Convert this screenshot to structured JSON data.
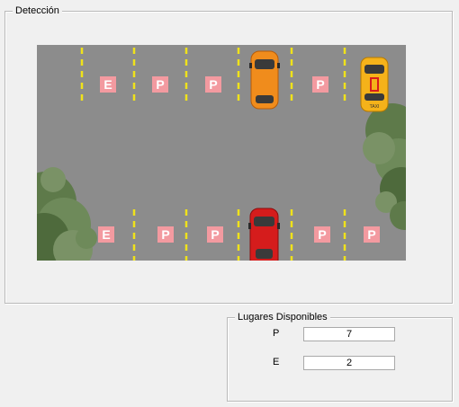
{
  "deteccion": {
    "title": "Detección",
    "lot": {
      "top_row": [
        "E",
        "P",
        "P",
        "",
        "P",
        ""
      ],
      "bottom_row": [
        "E",
        "P",
        "P",
        "",
        "P",
        "P"
      ],
      "taxi_label": "TAXI"
    },
    "colors": {
      "asphalt": "#8c8c8c",
      "line": "#f0e21a",
      "sign_bg": "#f39aa0",
      "orange_car": "#f08c1c",
      "red_car": "#d51c1c",
      "taxi": "#f5b21a",
      "tree": "#5e7a4a"
    }
  },
  "lugares": {
    "title": "Lugares Disponibles",
    "p_label": "P",
    "p_value": "7",
    "e_label": "E",
    "e_value": "2"
  }
}
